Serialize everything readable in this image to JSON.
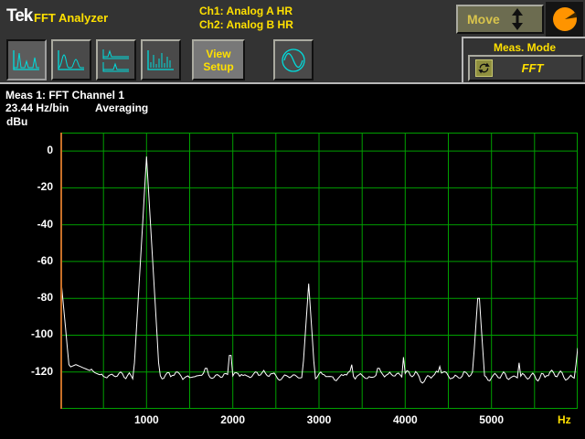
{
  "header": {
    "logo": "Tek",
    "app_title": "FFT Analyzer",
    "ch1_label": "Ch1: Analog A HR",
    "ch2_label": "Ch2: Analog B HR",
    "move_label": "Move"
  },
  "toolbar": {
    "view_setup_line1": "View",
    "view_setup_line2": "Setup",
    "meas_mode_label": "Meas. Mode",
    "meas_mode_value": "FFT"
  },
  "measurement": {
    "title": "Meas 1: FFT Channel 1",
    "resolution": "23.44 Hz/bin",
    "acquisition_mode": "Averaging"
  },
  "axes": {
    "y_unit": "dBu",
    "x_unit": "Hz"
  },
  "icons": {
    "toolbar_views": [
      "spectrum-view-1-icon",
      "spectrum-view-2-icon",
      "dual-spectrum-view-icon",
      "comb-spectrum-view-icon"
    ],
    "sine_button": "sine-wave-icon",
    "move_arrow": "up-down-arrow-icon",
    "knob": "rotary-knob-icon",
    "meas_mode": "cycle-arrows-icon"
  },
  "colors": {
    "chrome_gray": "#333333",
    "accent_yellow": "#ffe000",
    "icon_cyan": "#00dcdc",
    "grid_green": "#00a000",
    "trace_white": "#ffffff",
    "cursor_orange": "#c87028",
    "knob_orange": "#ff9400"
  },
  "chart_data": {
    "type": "line",
    "title": "Meas 1: FFT Channel 1",
    "xlabel": "Hz",
    "ylabel": "dBu",
    "x_range": [
      0,
      6000
    ],
    "y_range_dbu": [
      -140,
      10
    ],
    "x_grid_step_hz": 500,
    "x_tick_values": [
      1000,
      2000,
      3000,
      4000,
      5000
    ],
    "y_tick_values": [
      0,
      -20,
      -40,
      -60,
      -80,
      -100,
      -120
    ],
    "resolution_hz_per_bin": 23.44,
    "averaging": true,
    "grid": true,
    "noise_floor_dbu": -122,
    "noise_ripple_db": 2.5,
    "peaks": [
      {
        "freq_hz": 0,
        "level_dbu": -66,
        "slope_db_per_hz": 0.5
      },
      {
        "freq_hz": 180,
        "level_dbu": -116,
        "slope_db_per_hz": 0.02
      },
      {
        "freq_hz": 1000,
        "level_dbu": -3,
        "slope_db_per_hz": 0.8
      },
      {
        "freq_hz": 1690,
        "level_dbu": -113,
        "slope_db_per_hz": 0.5
      },
      {
        "freq_hz": 1970,
        "level_dbu": -105,
        "slope_db_per_hz": 0.6
      },
      {
        "freq_hz": 2450,
        "level_dbu": -116,
        "slope_db_per_hz": 0.5
      },
      {
        "freq_hz": 2880,
        "level_dbu": -72,
        "slope_db_per_hz": 0.7
      },
      {
        "freq_hz": 3380,
        "level_dbu": -116,
        "slope_db_per_hz": 0.5
      },
      {
        "freq_hz": 3690,
        "level_dbu": -113,
        "slope_db_per_hz": 0.5
      },
      {
        "freq_hz": 3980,
        "level_dbu": -112,
        "slope_db_per_hz": 0.55
      },
      {
        "freq_hz": 4400,
        "level_dbu": -117,
        "slope_db_per_hz": 0.5
      },
      {
        "freq_hz": 4850,
        "level_dbu": -73,
        "slope_db_per_hz": 0.7
      },
      {
        "freq_hz": 5320,
        "level_dbu": -115,
        "slope_db_per_hz": 0.5
      },
      {
        "freq_hz": 5650,
        "level_dbu": -117,
        "slope_db_per_hz": 0.5
      },
      {
        "freq_hz": 6000,
        "level_dbu": -107,
        "slope_db_per_hz": 0.45
      }
    ]
  }
}
